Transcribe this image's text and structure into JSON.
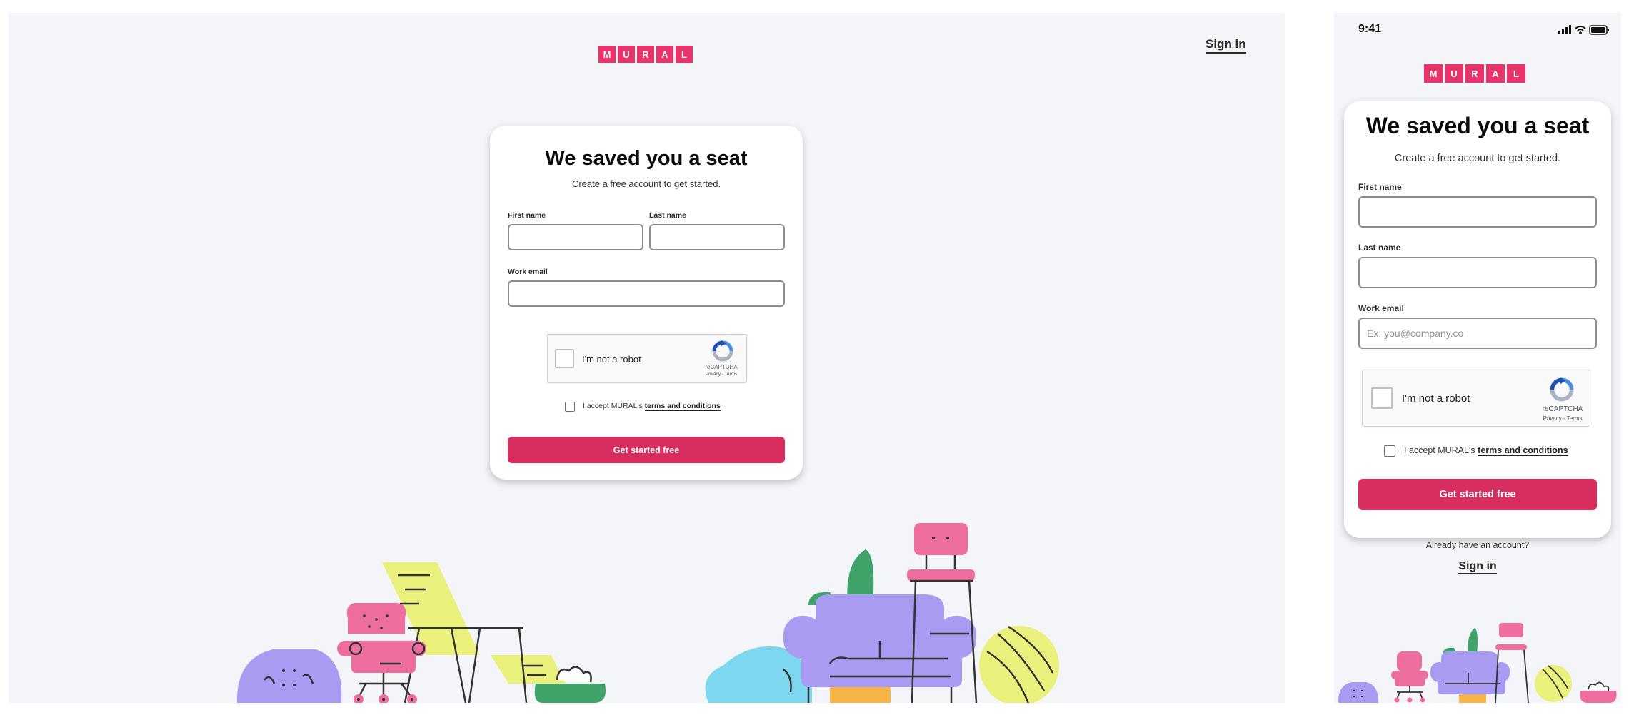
{
  "brand": {
    "letters": [
      "M",
      "U",
      "R",
      "A",
      "L"
    ],
    "color": "#e8336b"
  },
  "desktop": {
    "signin_label": "Sign in"
  },
  "form": {
    "title": "We saved you a seat",
    "subtitle": "Create a free account to get started.",
    "first_name_label": "First name",
    "last_name_label": "Last name",
    "work_email_label": "Work email",
    "work_email_placeholder": "Ex: you@company.co",
    "first_name_value": "",
    "last_name_value": "",
    "work_email_value": "",
    "captcha_label": "I'm not a robot",
    "captcha_brand": "reCAPTCHA",
    "captcha_links": "Privacy - Terms",
    "terms_prefix": "I accept MURAL's",
    "terms_link": "terms and conditions",
    "cta_label": "Get started free",
    "cta_color": "#d72d5f"
  },
  "mobile": {
    "status_time": "9:41",
    "already_text": "Already have an account?",
    "signin_label": "Sign in"
  },
  "illustration_colors": {
    "purple": "#a89bf1",
    "pink": "#ec6d9e",
    "yellow": "#eaf07c",
    "green": "#3fa36a",
    "cyan": "#7dd8ef",
    "orange": "#f5b445"
  }
}
